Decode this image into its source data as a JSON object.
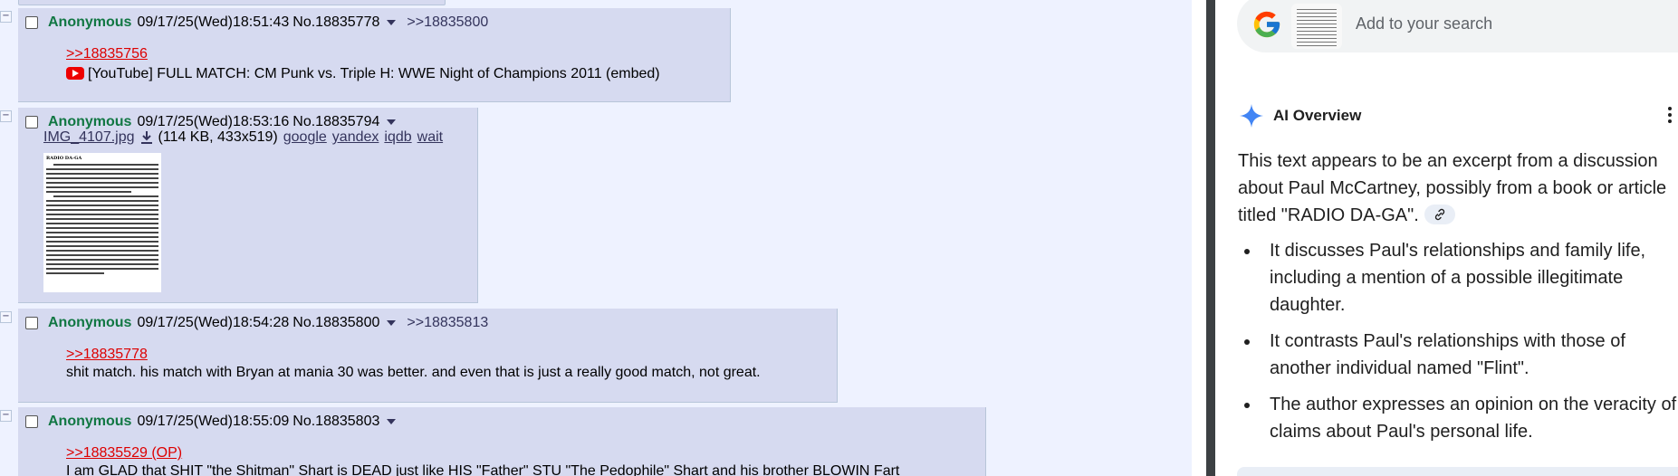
{
  "thread": {
    "posts": [
      {
        "name": "Anonymous",
        "datetime": "09/17/25(Wed)18:51:43",
        "number": "No.18835778",
        "backlinks": ">>18835800",
        "quote": ">>18835756",
        "body": "[YouTube] FULL MATCH: CM Punk vs. Triple H: WWE Night of Champions 2011 (embed)"
      },
      {
        "name": "Anonymous",
        "datetime": "09/17/25(Wed)18:53:16",
        "number": "No.18835794",
        "file": {
          "filename": "IMG_4107.jpg",
          "info": "(114 KB, 433x519)",
          "search_links": [
            "google",
            "yandex",
            "iqdb",
            "wait"
          ],
          "thumb_title": "RADIO DA-GA"
        }
      },
      {
        "name": "Anonymous",
        "datetime": "09/17/25(Wed)18:54:28",
        "number": "No.18835800",
        "backlinks": ">>18835813",
        "quote": ">>18835778",
        "body": "shit match. his match with Bryan at mania 30 was better. and even that is just a really good match, not great."
      },
      {
        "name": "Anonymous",
        "datetime": "09/17/25(Wed)18:55:09",
        "number": "No.18835803",
        "quote": ">>18835529 (OP)",
        "body": "I am GLAD that SHIT \"the Shitman\" Shart is DEAD just like HIS \"Father\" STU \"The Pedophile\" Shart and his brother BLOWIN Fart"
      }
    ],
    "hide_glyph": "−"
  },
  "google": {
    "search_placeholder": "Add to your search",
    "ai_overview": {
      "title": "AI Overview",
      "intro": "This text appears to be an excerpt from a discussion about Paul McCartney, possibly from a book or article titled \"RADIO DA-GA\".",
      "bullets": [
        "It discusses Paul's relationships and family life, including a mention of a possible illegitimate daughter.",
        "It contrasts Paul's relationships with those of another individual named \"Flint\".",
        "The author expresses an opinion on the veracity of claims about Paul's personal life."
      ]
    }
  },
  "colors": {
    "post_bg": "#d6daf0",
    "name_green": "#117743",
    "quote_red": "#dd0000",
    "link_blue": "#34345c",
    "page_bg": "#eef2ff"
  },
  "icons": [
    "hide-post-icon",
    "post-menu-caret-icon",
    "download-icon",
    "youtube-icon",
    "google-logo-icon",
    "ai-sparkle-icon",
    "more-options-icon",
    "citation-link-icon"
  ]
}
